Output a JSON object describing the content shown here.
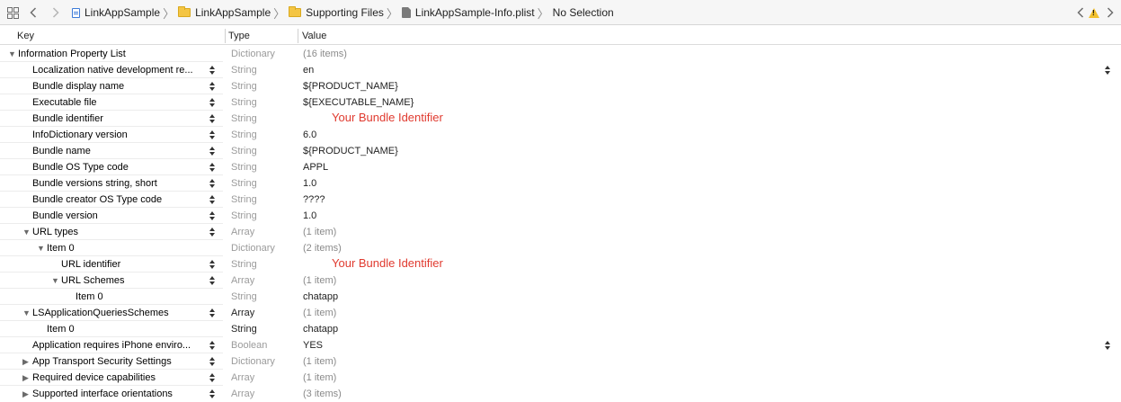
{
  "jumpbar": {
    "project": "LinkAppSample",
    "group1": "LinkAppSample",
    "group2": "Supporting Files",
    "file": "LinkAppSample-Info.plist",
    "selection": "No Selection"
  },
  "header": {
    "key": "Key",
    "type": "Type",
    "value": "Value"
  },
  "rows": [
    {
      "key": "Information Property List",
      "type": "Dictionary",
      "value": "(16 items)"
    },
    {
      "key": "Localization native development re...",
      "type": "String",
      "value": "en"
    },
    {
      "key": "Bundle display name",
      "type": "String",
      "value": "${PRODUCT_NAME}"
    },
    {
      "key": "Executable file",
      "type": "String",
      "value": "${EXECUTABLE_NAME}"
    },
    {
      "key": "Bundle identifier",
      "type": "String",
      "value": "",
      "annotation": "Your Bundle Identifier"
    },
    {
      "key": "InfoDictionary version",
      "type": "String",
      "value": "6.0"
    },
    {
      "key": "Bundle name",
      "type": "String",
      "value": "${PRODUCT_NAME}"
    },
    {
      "key": "Bundle OS Type code",
      "type": "String",
      "value": "APPL"
    },
    {
      "key": "Bundle versions string, short",
      "type": "String",
      "value": "1.0"
    },
    {
      "key": "Bundle creator OS Type code",
      "type": "String",
      "value": "????"
    },
    {
      "key": "Bundle version",
      "type": "String",
      "value": "1.0"
    },
    {
      "key": "URL types",
      "type": "Array",
      "value": "(1 item)"
    },
    {
      "key": "Item 0",
      "type": "Dictionary",
      "value": "(2 items)"
    },
    {
      "key": "URL identifier",
      "type": "String",
      "value": "",
      "annotation": "Your Bundle Identifier"
    },
    {
      "key": "URL Schemes",
      "type": "Array",
      "value": "(1 item)"
    },
    {
      "key": "Item 0",
      "type": "String",
      "value": "chatapp"
    },
    {
      "key": "LSApplicationQueriesSchemes",
      "type": "Array",
      "value": "(1 item)"
    },
    {
      "key": "Item 0",
      "type": "String",
      "value": "chatapp"
    },
    {
      "key": "Application requires iPhone enviro...",
      "type": "Boolean",
      "value": "YES"
    },
    {
      "key": "App Transport Security Settings",
      "type": "Dictionary",
      "value": "(1 item)"
    },
    {
      "key": "Required device capabilities",
      "type": "Array",
      "value": "(1 item)"
    },
    {
      "key": "Supported interface orientations",
      "type": "Array",
      "value": "(3 items)"
    }
  ]
}
